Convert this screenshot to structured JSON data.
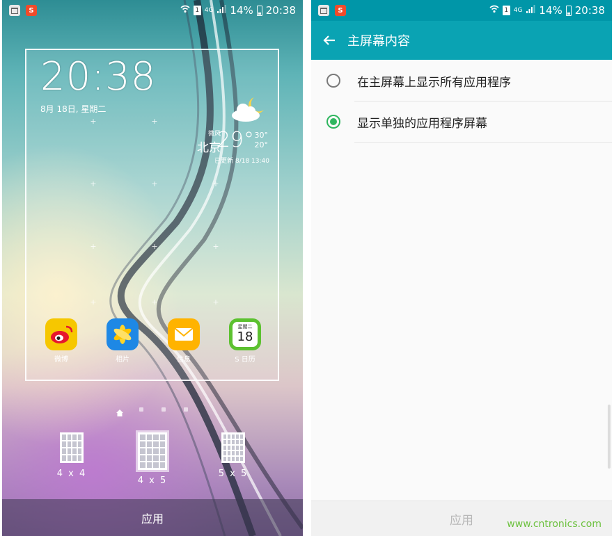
{
  "status_bar": {
    "left_icons": [
      "notification-icon",
      "app-s-icon"
    ],
    "battery_percent": "14%",
    "time": "20:38",
    "network": "4G"
  },
  "left_screen": {
    "clock": {
      "time": "20:38",
      "date": "8月 18日, 星期二"
    },
    "weather": {
      "location_label": "微风",
      "city": "北京",
      "temperature": "29°",
      "high": "30°",
      "low": "20°",
      "updated": "已更新 8/18 13:40"
    },
    "apps": [
      {
        "label": "微博",
        "icon": "weibo-icon"
      },
      {
        "label": "相片",
        "icon": "gallery-icon"
      },
      {
        "label": "信息",
        "icon": "messages-icon"
      },
      {
        "label": "S 日历",
        "icon": "calendar-icon",
        "calendar_weekday": "星期二",
        "calendar_day": "18"
      }
    ],
    "page_indicator": {
      "pages": 4,
      "current": 0
    },
    "grid_options": [
      "4 x 4",
      "4 x 5",
      "5 x 5"
    ],
    "selected_grid": "4 x 5",
    "apply_label": "应用"
  },
  "right_screen": {
    "title": "主屏幕内容",
    "options": [
      {
        "label": "在主屏幕上显示所有应用程序",
        "checked": false
      },
      {
        "label": "显示单独的应用程序屏幕",
        "checked": true
      }
    ],
    "apply_label": "应用",
    "accent_color": "#2fb65f",
    "toolbar_color": "#0aa3b3"
  },
  "watermark": "www.cntronics.com"
}
